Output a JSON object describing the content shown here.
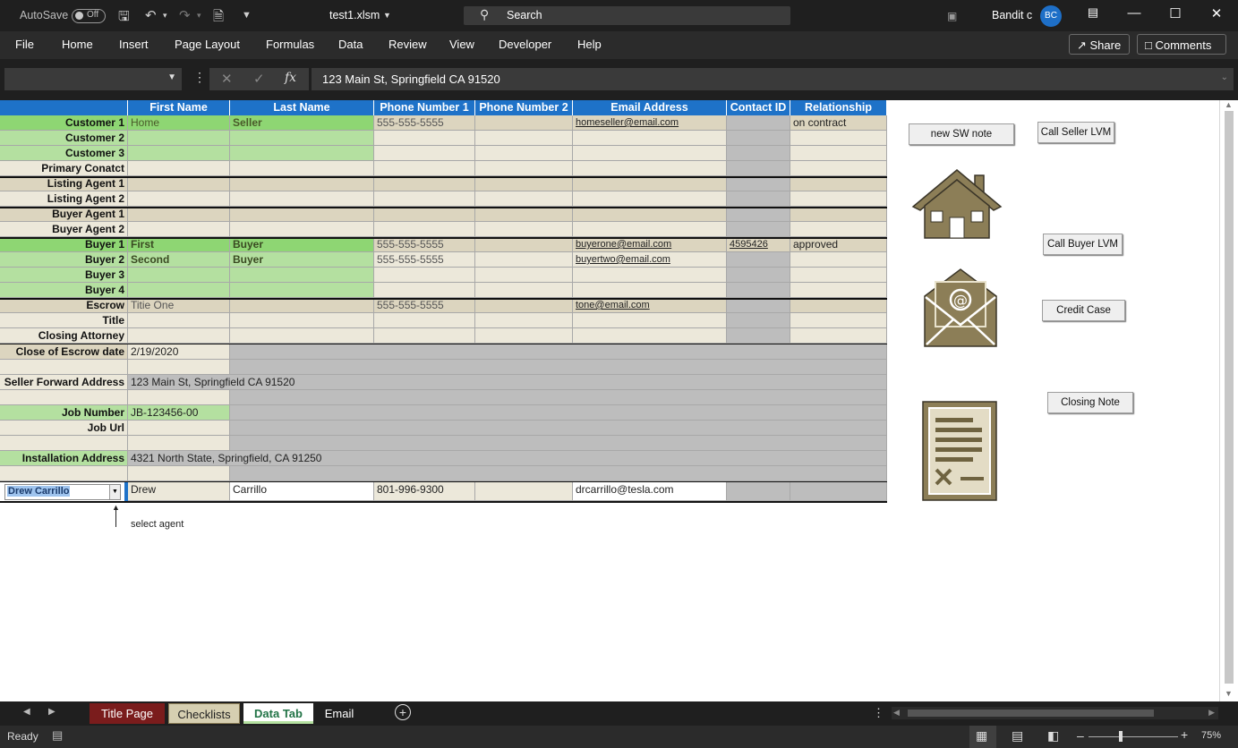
{
  "titlebar": {
    "autosave_label": "AutoSave",
    "autosave_state": "Off",
    "filename": "test1.xlsm",
    "search_placeholder": "Search",
    "user_name": "Bandit c",
    "user_initials": "BC"
  },
  "menu": {
    "items": [
      "File",
      "Home",
      "Insert",
      "Page Layout",
      "Formulas",
      "Data",
      "Review",
      "View",
      "Developer",
      "Help"
    ],
    "share": "Share",
    "comments": "Comments"
  },
  "formula_bar": {
    "name_box": "",
    "content": "123 Main St, Springfield CA 91520"
  },
  "sheet": {
    "headers": [
      "First Name",
      "Last Name",
      "Phone Number 1",
      "Phone Number 2",
      "Email Address",
      "Contact ID",
      "Relationship"
    ],
    "rows": [
      {
        "label": "Customer 1",
        "first": "Home",
        "last": "Seller",
        "phone1": "555-555-5555",
        "phone2": "",
        "email": "homeseller@email.com",
        "contact_id": "",
        "relationship": "on contract"
      },
      {
        "label": "Customer 2",
        "first": "",
        "last": "",
        "phone1": "",
        "phone2": "",
        "email": "",
        "contact_id": "",
        "relationship": ""
      },
      {
        "label": "Customer 3",
        "first": "",
        "last": "",
        "phone1": "",
        "phone2": "",
        "email": "",
        "contact_id": "",
        "relationship": ""
      },
      {
        "label": "Primary Conatct",
        "first": "",
        "last": "",
        "phone1": "",
        "phone2": "",
        "email": "",
        "contact_id": "",
        "relationship": ""
      },
      {
        "label": "Listing Agent 1",
        "first": "",
        "last": "",
        "phone1": "",
        "phone2": "",
        "email": "",
        "contact_id": "",
        "relationship": ""
      },
      {
        "label": "Listing Agent 2",
        "first": "",
        "last": "",
        "phone1": "",
        "phone2": "",
        "email": "",
        "contact_id": "",
        "relationship": ""
      },
      {
        "label": "Buyer Agent 1",
        "first": "",
        "last": "",
        "phone1": "",
        "phone2": "",
        "email": "",
        "contact_id": "",
        "relationship": ""
      },
      {
        "label": "Buyer Agent 2",
        "first": "",
        "last": "",
        "phone1": "",
        "phone2": "",
        "email": "",
        "contact_id": "",
        "relationship": ""
      },
      {
        "label": "Buyer 1",
        "first": "First",
        "last": "Buyer",
        "phone1": "555-555-5555",
        "phone2": "",
        "email": "buyerone@email.com",
        "contact_id": "4595426",
        "relationship": "approved"
      },
      {
        "label": "Buyer 2",
        "first": "Second",
        "last": "Buyer",
        "phone1": "555-555-5555",
        "phone2": "",
        "email": "buyertwo@email.com",
        "contact_id": "",
        "relationship": ""
      },
      {
        "label": "Buyer 3",
        "first": "",
        "last": "",
        "phone1": "",
        "phone2": "",
        "email": "",
        "contact_id": "",
        "relationship": ""
      },
      {
        "label": "Buyer 4",
        "first": "",
        "last": "",
        "phone1": "",
        "phone2": "",
        "email": "",
        "contact_id": "",
        "relationship": ""
      },
      {
        "label": "Escrow",
        "first": "Titie One",
        "last": "",
        "phone1": "555-555-5555",
        "phone2": "",
        "email": "tone@email.com",
        "contact_id": "",
        "relationship": ""
      },
      {
        "label": "Title",
        "first": "",
        "last": "",
        "phone1": "",
        "phone2": "",
        "email": "",
        "contact_id": "",
        "relationship": ""
      },
      {
        "label": "Closing Attorney",
        "first": "",
        "last": "",
        "phone1": "",
        "phone2": "",
        "email": "",
        "contact_id": "",
        "relationship": ""
      }
    ],
    "close_of_escrow_label": "Close of Escrow date",
    "close_of_escrow_value": "2/19/2020",
    "seller_forward_label": "Seller Forward Address",
    "seller_forward_value": "123 Main St, Springfield CA 91520",
    "job_number_label": "Job Number",
    "job_number_value": "JB-123456-00",
    "job_url_label": "Job Url",
    "installation_label": "Installation Address",
    "installation_value": "4321 North State, Springfield, CA 91250",
    "agent": {
      "selected": "Drew Carrillo",
      "first": "Drew",
      "last": "Carrillo",
      "phone": "801-996-9300",
      "email": "drcarrillo@tesla.com",
      "hint": "select agent"
    }
  },
  "buttons": {
    "new_sw_note": "new SW note",
    "call_seller": "Call Seller LVM",
    "call_buyer": "Call Buyer LVM",
    "credit_case": "Credit Case",
    "closing_note": "Closing Note"
  },
  "tabs": [
    {
      "label": "Title Page",
      "color": "#7a1c1c",
      "text": "#ffffff"
    },
    {
      "label": "Checklists",
      "color": "#d6cfb1",
      "text": "#222222"
    },
    {
      "label": "Data Tab",
      "color": "#ffffff",
      "text": "#217346",
      "active": true
    },
    {
      "label": "Email",
      "color": "#1f1f1f",
      "text": "#ffffff"
    }
  ],
  "status": {
    "ready": "Ready",
    "zoom": "75%"
  },
  "colors": {
    "header_blue": "#1e72c8",
    "icon_olive": "#8c7e57"
  }
}
